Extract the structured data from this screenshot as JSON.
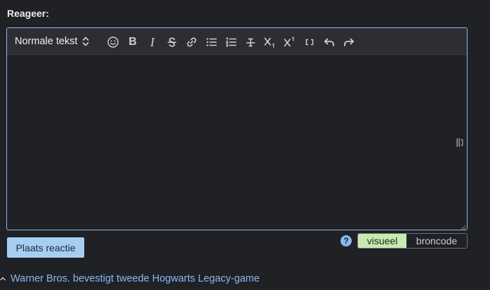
{
  "comment": {
    "heading": "Reageer:",
    "toolbar": {
      "format_select_value": "Normale tekst",
      "buttons": [
        {
          "icon": "smiley-icon"
        },
        {
          "icon": "bold-icon",
          "label": "B"
        },
        {
          "icon": "italic-icon",
          "label": "I"
        },
        {
          "icon": "strikethrough-icon"
        },
        {
          "icon": "link-icon"
        },
        {
          "icon": "bullet-list-icon"
        },
        {
          "icon": "numbered-list-icon"
        },
        {
          "icon": "horizontal-rule-icon"
        },
        {
          "icon": "subscript-icon"
        },
        {
          "icon": "superscript-icon"
        },
        {
          "icon": "code-icon"
        },
        {
          "icon": "undo-icon"
        },
        {
          "icon": "redo-icon"
        }
      ]
    },
    "editor_value": "",
    "submit_label": "Plaats reactie",
    "mode_toggle": {
      "visual_label": "visueel",
      "source_label": "broncode",
      "active": "visueel"
    }
  },
  "related_article": {
    "title": "Warner Bros. bevestigt tweede Hogwarts Legacy-game"
  },
  "colors": {
    "background": "#1f2125",
    "editor_border": "#8fb7ea",
    "toolbar_bg": "#2c2e33",
    "submit_bg": "#a8cdf3",
    "active_toggle_bg": "#c7eab3",
    "link": "#8ab8ef"
  }
}
